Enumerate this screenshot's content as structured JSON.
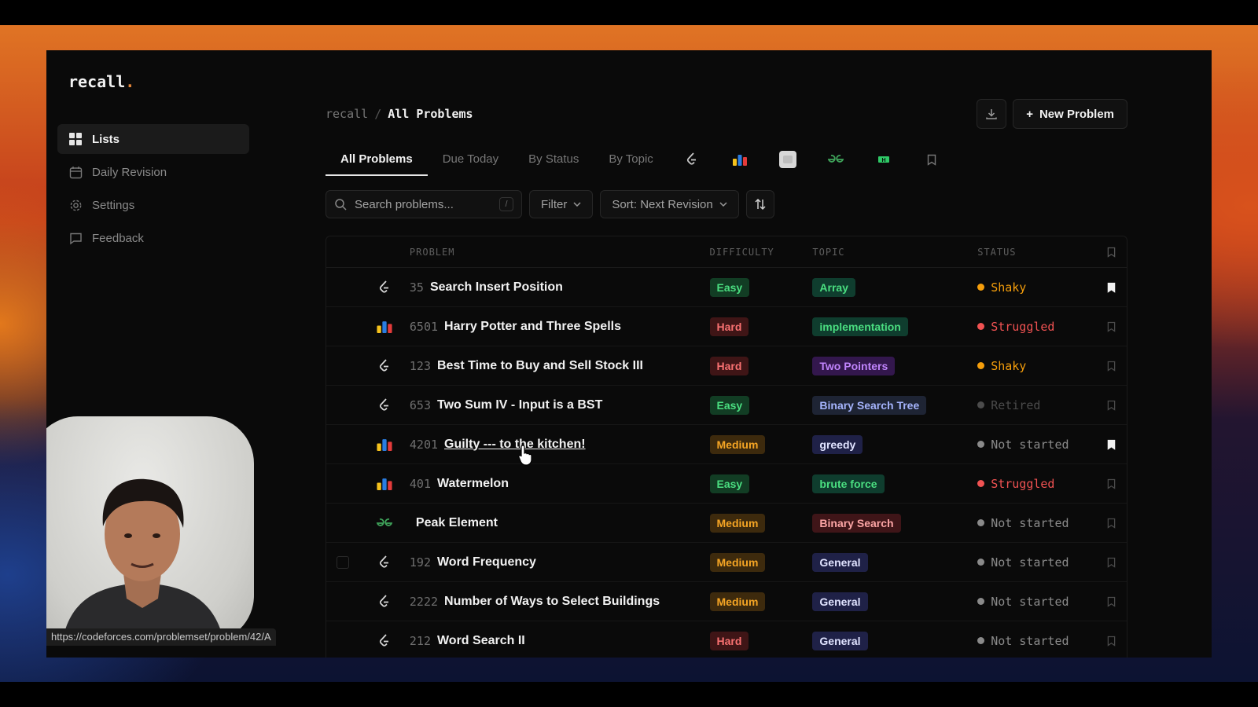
{
  "app": {
    "logo": "recall",
    "logo_dot": "."
  },
  "sidebar": {
    "items": [
      {
        "label": "Lists",
        "icon": "grid-icon",
        "active": true
      },
      {
        "label": "Daily Revision",
        "icon": "calendar-icon",
        "active": false
      },
      {
        "label": "Settings",
        "icon": "gear-icon",
        "active": false
      },
      {
        "label": "Feedback",
        "icon": "chat-icon",
        "active": false
      }
    ]
  },
  "statusbar": {
    "url": "https://codeforces.com/problemset/problem/42/A"
  },
  "breadcrumb": {
    "root": "recall",
    "sep": "/",
    "current": "All Problems"
  },
  "actions": {
    "download_icon": "download-icon",
    "new_problem": "New Problem",
    "plus": "+"
  },
  "tabs": [
    {
      "label": "All Problems",
      "active": true
    },
    {
      "label": "Due Today"
    },
    {
      "label": "By Status"
    },
    {
      "label": "By Topic"
    }
  ],
  "platform_tabs": [
    "leetcode-icon",
    "codeforces-icon",
    "gfg-square-icon",
    "geeksforgeeks-icon",
    "hackerrank-icon",
    "bookmark-icon"
  ],
  "toolbar": {
    "search_placeholder": "Search problems...",
    "search_kbd": "/",
    "filter_label": "Filter",
    "sort_label": "Sort: Next Revision"
  },
  "table": {
    "headers": {
      "problem": "PROBLEM",
      "difficulty": "DIFFICULTY",
      "topic": "TOPIC",
      "status": "STATUS"
    },
    "rows": [
      {
        "platform": "leetcode-icon",
        "num": "35",
        "title": "Search Insert Position",
        "difficulty": "Easy",
        "topic": "Array",
        "topic_color": "teal",
        "status": "Shaky",
        "status_color": "orange",
        "bookmarked": true
      },
      {
        "platform": "codeforces-icon",
        "num": "6501",
        "title": "Harry Potter and Three Spells",
        "difficulty": "Hard",
        "topic": "implementation",
        "topic_color": "teal",
        "status": "Struggled",
        "status_color": "red",
        "bookmarked": false
      },
      {
        "platform": "leetcode-icon",
        "num": "123",
        "title": "Best Time to Buy and Sell Stock III",
        "difficulty": "Hard",
        "topic": "Two Pointers",
        "topic_color": "purple",
        "status": "Shaky",
        "status_color": "orange",
        "bookmarked": false
      },
      {
        "platform": "leetcode-icon",
        "num": "653",
        "title": "Two Sum IV - Input is a BST",
        "difficulty": "Easy",
        "topic": "Binary Search Tree",
        "topic_color": "slate",
        "status": "Retired",
        "status_color": "gray-dim",
        "bookmarked": false
      },
      {
        "platform": "codeforces-icon",
        "num": "4201",
        "title": "Guilty --- to the kitchen!",
        "difficulty": "Medium",
        "topic": "greedy",
        "topic_color": "indigo",
        "status": "Not started",
        "status_color": "gray",
        "bookmarked": true,
        "link": true
      },
      {
        "platform": "codeforces-icon",
        "num": "401",
        "title": "Watermelon",
        "difficulty": "Easy",
        "topic": "brute force",
        "topic_color": "teal",
        "status": "Struggled",
        "status_color": "red",
        "bookmarked": false
      },
      {
        "platform": "geeksforgeeks-icon",
        "num": "",
        "title": "Peak Element",
        "difficulty": "Medium",
        "topic": "Binary Search",
        "topic_color": "rose",
        "status": "Not started",
        "status_color": "gray",
        "bookmarked": false
      },
      {
        "platform": "leetcode-icon",
        "num": "192",
        "title": "Word Frequency",
        "difficulty": "Medium",
        "topic": "General",
        "topic_color": "indigo",
        "status": "Not started",
        "status_color": "gray",
        "bookmarked": false
      },
      {
        "platform": "leetcode-icon",
        "num": "2222",
        "title": "Number of Ways to Select Buildings",
        "difficulty": "Medium",
        "topic": "General",
        "topic_color": "indigo",
        "status": "Not started",
        "status_color": "gray",
        "bookmarked": false
      },
      {
        "platform": "leetcode-icon",
        "num": "212",
        "title": "Word Search II",
        "difficulty": "Hard",
        "topic": "General",
        "topic_color": "indigo",
        "status": "Not started",
        "status_color": "gray",
        "bookmarked": false
      }
    ]
  },
  "colors": {
    "easy": {
      "bg": "#123d24",
      "fg": "#4ade80"
    },
    "medium": {
      "bg": "#3d2a0d",
      "fg": "#f5a524"
    },
    "hard": {
      "bg": "#3f1516",
      "fg": "#f87171"
    },
    "teal": {
      "bg": "#0f3d2e",
      "fg": "#4ade80"
    },
    "purple": {
      "bg": "#33174d",
      "fg": "#c084fc"
    },
    "slate": {
      "bg": "#1e2434",
      "fg": "#a5b4fc"
    },
    "indigo": {
      "bg": "#1f2147",
      "fg": "#e0e3ff"
    },
    "rose": {
      "bg": "#3f1518",
      "fg": "#fca5a5"
    },
    "orange": "#f59e0b",
    "red": "#f05252",
    "gray": "#8a8a8a",
    "gray-dim": "#4b4b4b"
  }
}
